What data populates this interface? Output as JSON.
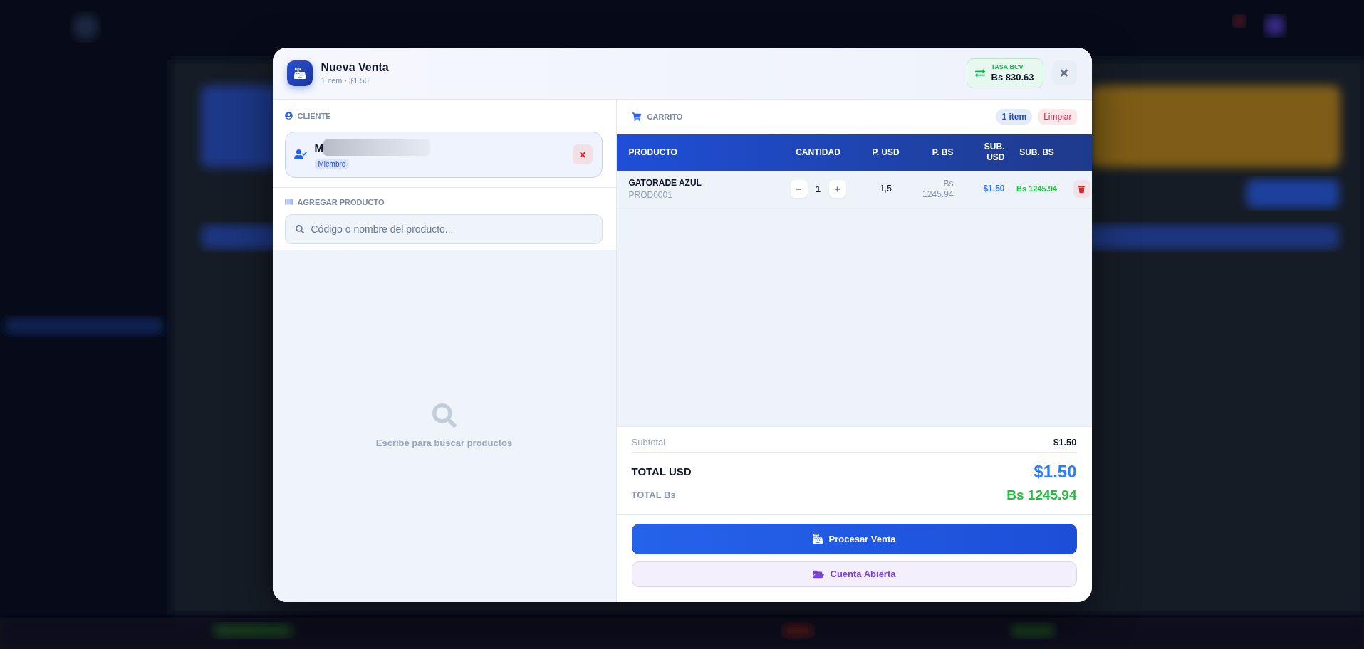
{
  "dialog": {
    "title": "Nueva Venta",
    "subtitle": "1 item · $1.50",
    "rate": {
      "label": "TASA BCV",
      "value": "Bs 830.63"
    }
  },
  "client_section": {
    "label": "CLIENTE",
    "client": {
      "name": "M",
      "redacted": true,
      "badge": "Miembro"
    }
  },
  "product_search": {
    "label": "AGREGAR PRODUCTO",
    "placeholder": "Código o nombre del producto...",
    "empty_message": "Escribe para buscar productos"
  },
  "cart": {
    "label": "CARRITO",
    "count": "1 item",
    "clear_button": "Limpiar",
    "columns": [
      "PRODUCTO",
      "CANTIDAD",
      "P. USD",
      "P. BS",
      "SUB. USD",
      "SUB. BS"
    ],
    "rows": [
      {
        "name": "GATORADE AZUL",
        "code": "PROD0001",
        "quantity": "1",
        "price_usd": "1,5",
        "price_bs": "Bs 1245.94",
        "subtotal_usd": "$1.50",
        "subtotal_bs": "Bs 1245.94"
      }
    ]
  },
  "totals": {
    "subtotal_label": "Subtotal",
    "subtotal": "$1.50",
    "total_usd_label": "TOTAL USD",
    "total_usd": "$1.50",
    "total_bs_label": "TOTAL Bs",
    "total_bs": "Bs 1245.94"
  },
  "actions": [
    {
      "kind": "primary",
      "label": "Procesar Venta"
    },
    {
      "kind": "secondary",
      "label": "Cuenta Abierta"
    }
  ]
}
